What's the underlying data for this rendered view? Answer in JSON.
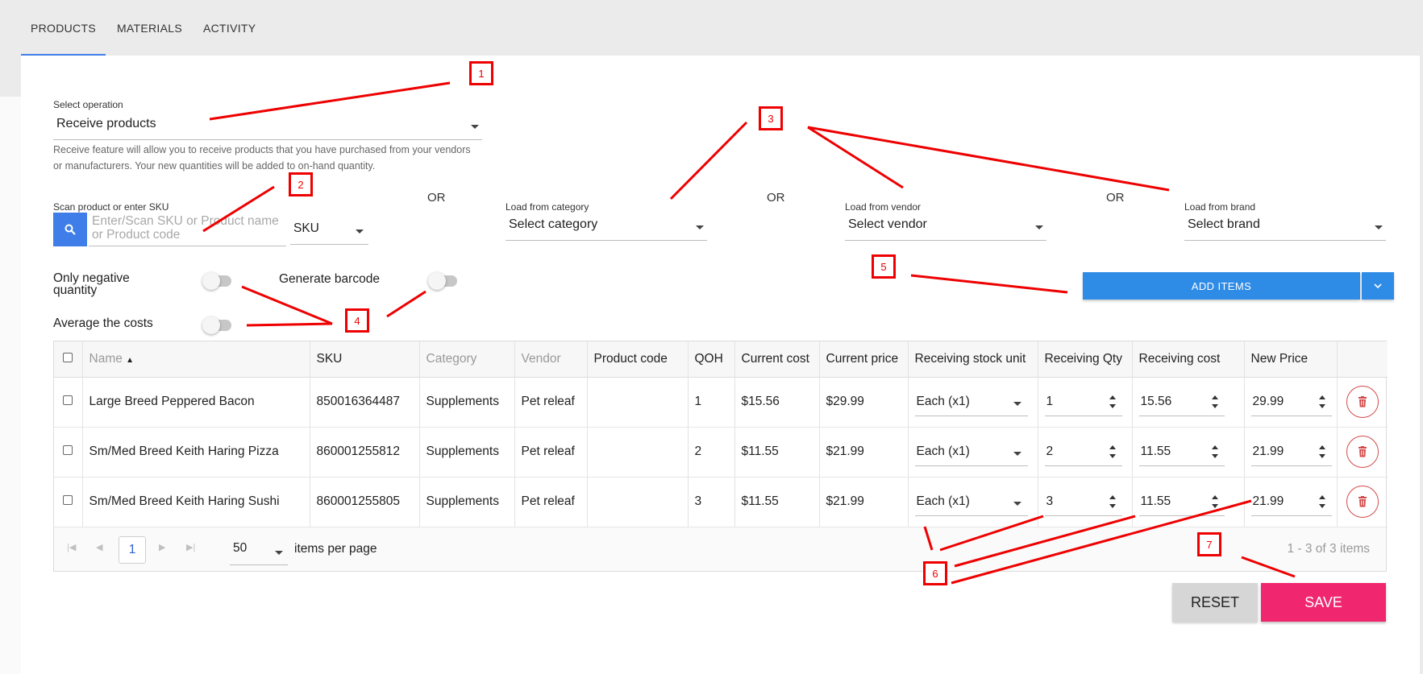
{
  "tabs": [
    {
      "label": "PRODUCTS",
      "active": true
    },
    {
      "label": "MATERIALS",
      "active": false
    },
    {
      "label": "ACTIVITY",
      "active": false
    }
  ],
  "operation": {
    "label": "Select operation",
    "value": "Receive products",
    "description_line1": "Receive feature will allow you to receive products that you have purchased from your vendors",
    "description_line2": "or manufacturers. Your new quantities will be added to on-hand quantity."
  },
  "scan": {
    "label": "Scan product or enter SKU",
    "placeholder": "Enter/Scan SKU or Product name or Product code",
    "mode": "SKU",
    "or": "OR"
  },
  "category": {
    "label": "Load from category",
    "value": "Select category"
  },
  "vendor": {
    "label": "Load from vendor",
    "value": "Select vendor"
  },
  "brand": {
    "label": "Load from brand",
    "value": "Select brand"
  },
  "toggles": {
    "only_negative_line1": "Only negative",
    "only_negative_line2": "quantity",
    "generate_barcode": "Generate barcode",
    "average_costs": "Average the costs"
  },
  "add_items": {
    "label": "ADD ITEMS"
  },
  "table": {
    "headers": {
      "name": "Name",
      "sku": "SKU",
      "category": "Category",
      "vendor": "Vendor",
      "product_code": "Product code",
      "qoh": "QOH",
      "current_cost": "Current cost",
      "current_price": "Current price",
      "receiving_unit": "Receiving stock unit",
      "receiving_qty": "Receiving Qty",
      "receiving_cost": "Receiving cost",
      "new_price": "New Price"
    },
    "rows": [
      {
        "name": "Large Breed Peppered Bacon",
        "sku": "850016364487",
        "category": "Supplements",
        "vendor": "Pet releaf",
        "product_code": "",
        "qoh": "1",
        "current_cost": "$15.56",
        "current_price": "$29.99",
        "unit": "Each (x1)",
        "qty": "1",
        "cost": "15.56",
        "new_price": "29.99"
      },
      {
        "name": "Sm/Med Breed Keith Haring Pizza",
        "sku": "860001255812",
        "category": "Supplements",
        "vendor": "Pet releaf",
        "product_code": "",
        "qoh": "2",
        "current_cost": "$11.55",
        "current_price": "$21.99",
        "unit": "Each (x1)",
        "qty": "2",
        "cost": "11.55",
        "new_price": "21.99"
      },
      {
        "name": "Sm/Med Breed Keith Haring Sushi",
        "sku": "860001255805",
        "category": "Supplements",
        "vendor": "Pet releaf",
        "product_code": "",
        "qoh": "3",
        "current_cost": "$11.55",
        "current_price": "$21.99",
        "unit": "Each (x1)",
        "qty": "3",
        "cost": "11.55",
        "new_price": "21.99"
      }
    ]
  },
  "pager": {
    "page": "1",
    "page_size": "50",
    "items_per_page": "items per page",
    "summary": "1 - 3 of 3 items"
  },
  "actions": {
    "reset": "RESET",
    "save": "SAVE"
  },
  "annotations": [
    "1",
    "2",
    "3",
    "4",
    "5",
    "6",
    "7"
  ],
  "colors": {
    "accent": "#3f7ee8",
    "add_items": "#2e8be6",
    "save": "#f0266f",
    "annotation": "#e00000",
    "delete": "#d34a4a"
  }
}
